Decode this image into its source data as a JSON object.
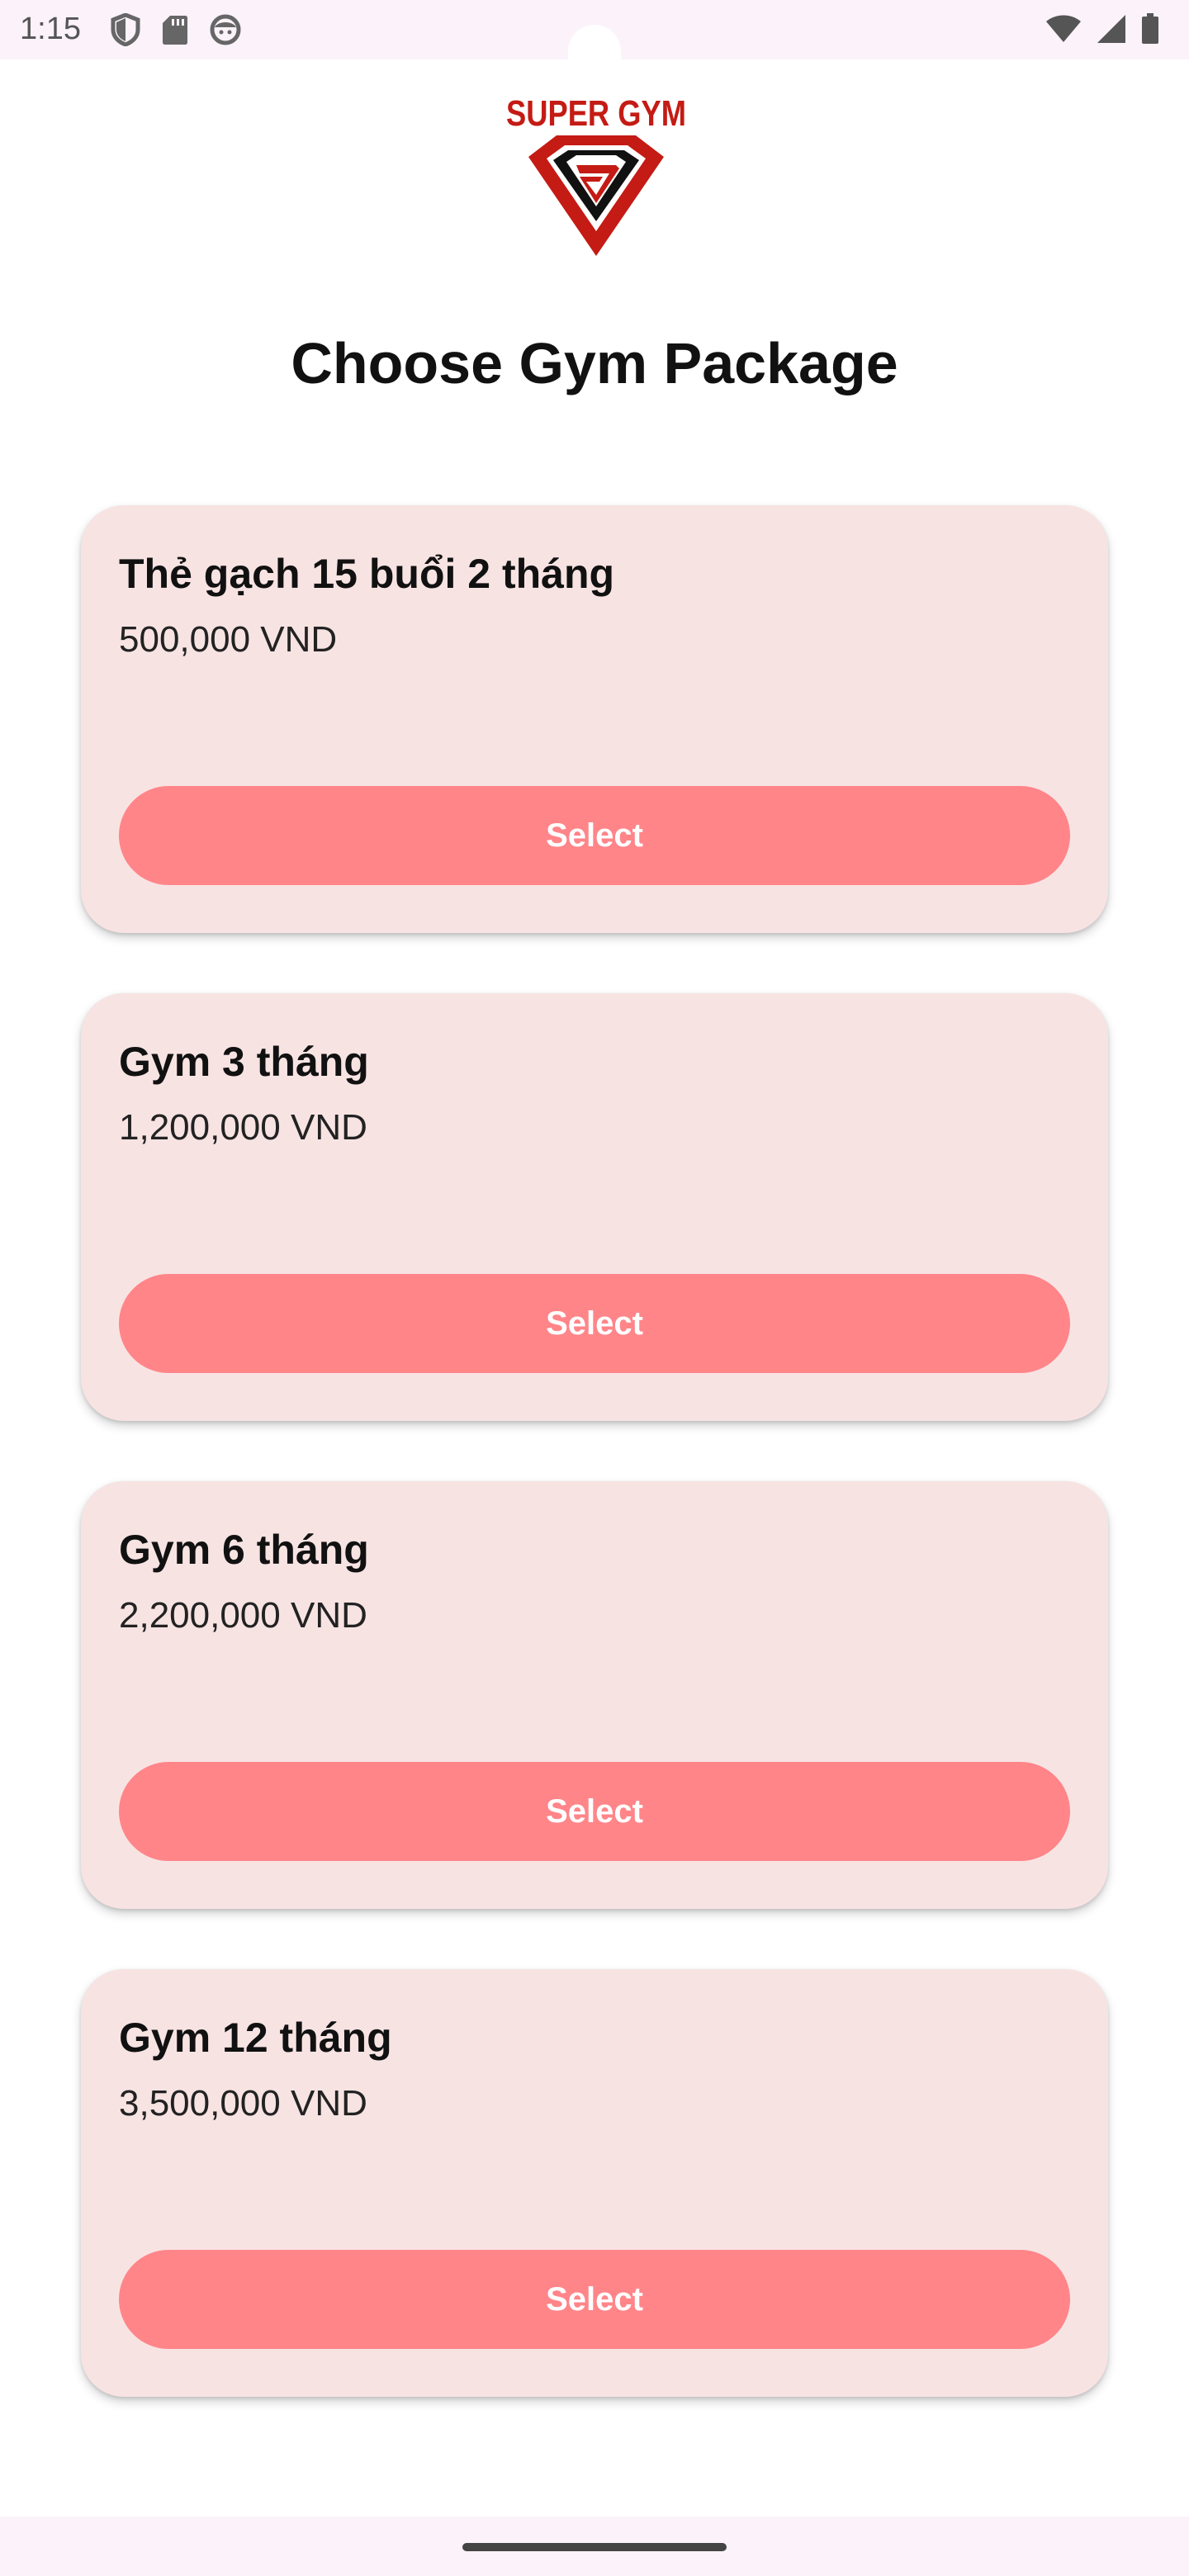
{
  "status_bar": {
    "time": "1:15",
    "icons_left": [
      "shield-icon",
      "sd-card-icon",
      "face-icon"
    ],
    "icons_right": [
      "wifi-icon",
      "signal-icon",
      "battery-icon"
    ]
  },
  "logo": {
    "text": "SUPER GYM",
    "brand_color": "#c41b14"
  },
  "page": {
    "title": "Choose Gym Package"
  },
  "packages": [
    {
      "name": "Thẻ gạch 15 buổi 2 tháng",
      "price": "500,000 VND",
      "button_label": "Select"
    },
    {
      "name": "Gym 3 tháng",
      "price": "1,200,000 VND",
      "button_label": "Select"
    },
    {
      "name": "Gym 6 tháng",
      "price": "2,200,000 VND",
      "button_label": "Select"
    },
    {
      "name": "Gym 12 tháng",
      "price": "3,500,000 VND",
      "button_label": "Select"
    }
  ],
  "colors": {
    "card_background": "#f8e3e3",
    "button_background": "#ff8589",
    "button_text": "#ffffff",
    "system_bar": "#fbf2fa"
  }
}
